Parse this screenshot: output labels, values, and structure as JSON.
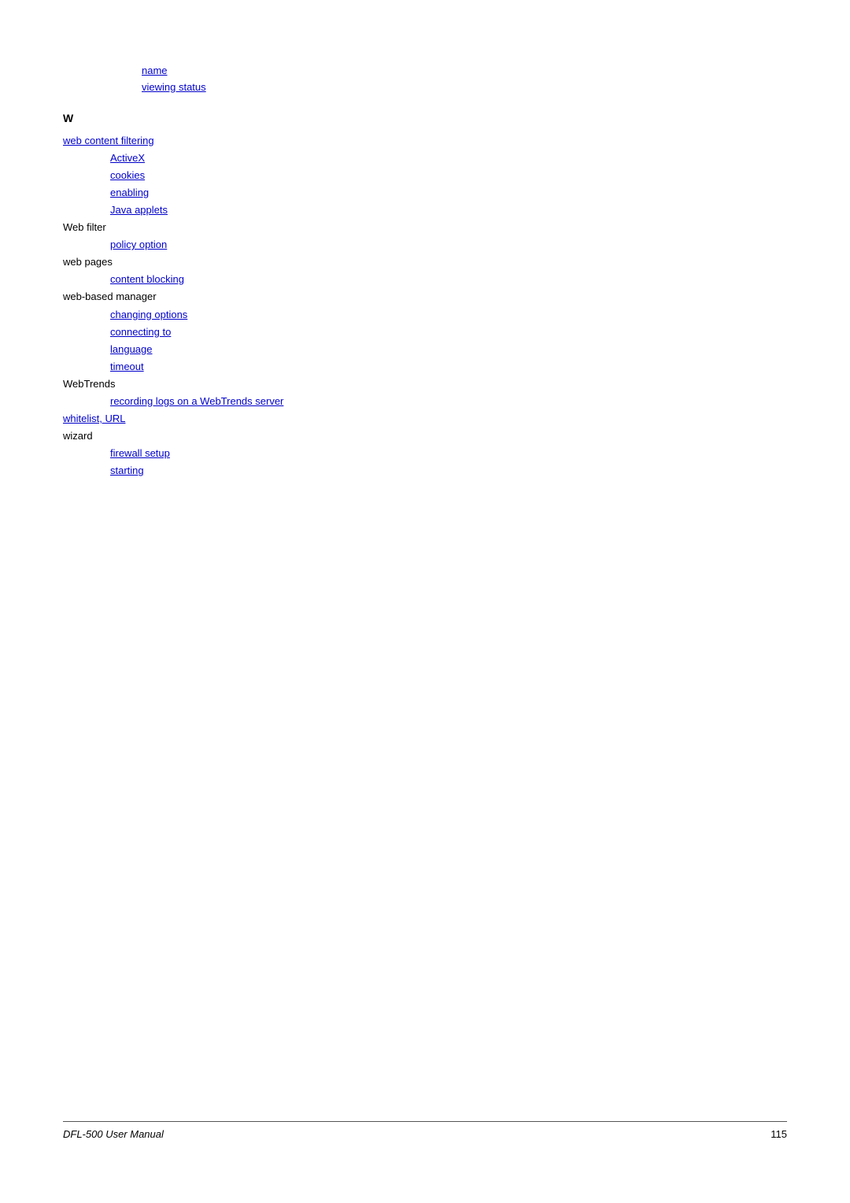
{
  "page": {
    "footer": {
      "manual": "DFL-500 User Manual",
      "page_number": "115"
    }
  },
  "prev_links": [
    {
      "label": "name",
      "href": "#"
    },
    {
      "label": "viewing status",
      "href": "#"
    }
  ],
  "section_w": {
    "header": "W",
    "entries": [
      {
        "level": 0,
        "type": "link",
        "text": "web content filtering"
      },
      {
        "level": 1,
        "type": "link",
        "text": "ActiveX"
      },
      {
        "level": 1,
        "type": "link",
        "text": "cookies"
      },
      {
        "level": 1,
        "type": "link",
        "text": "enabling"
      },
      {
        "level": 1,
        "type": "link",
        "text": "Java applets"
      },
      {
        "level": 0,
        "type": "text",
        "text": "Web filter"
      },
      {
        "level": 1,
        "type": "link",
        "text": "policy option"
      },
      {
        "level": 0,
        "type": "text",
        "text": "web pages"
      },
      {
        "level": 1,
        "type": "link",
        "text": "content blocking"
      },
      {
        "level": 0,
        "type": "text",
        "text": "web-based manager"
      },
      {
        "level": 1,
        "type": "link",
        "text": "changing options"
      },
      {
        "level": 1,
        "type": "link",
        "text": "connecting to"
      },
      {
        "level": 1,
        "type": "link",
        "text": "language"
      },
      {
        "level": 1,
        "type": "link",
        "text": "timeout"
      },
      {
        "level": 0,
        "type": "text",
        "text": "WebTrends"
      },
      {
        "level": 1,
        "type": "link",
        "text": "recording logs on a WebTrends server"
      },
      {
        "level": 0,
        "type": "link",
        "text": "whitelist, URL"
      },
      {
        "level": 0,
        "type": "text",
        "text": "wizard"
      },
      {
        "level": 1,
        "type": "link",
        "text": "firewall setup"
      },
      {
        "level": 1,
        "type": "link",
        "text": "starting"
      }
    ]
  }
}
